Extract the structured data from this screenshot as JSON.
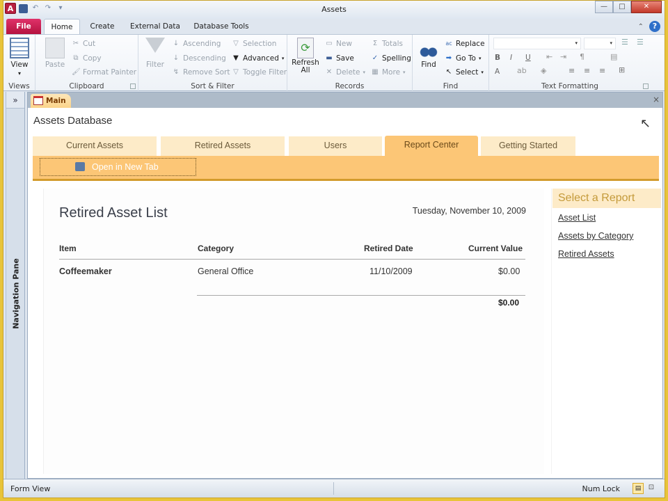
{
  "window": {
    "title": "Assets",
    "controls": {
      "minimize": "—",
      "maximize": "□",
      "close": "✕"
    }
  },
  "quick_access": {
    "app_icon": "A",
    "undo": "↶",
    "redo": "↷",
    "customize": "▾"
  },
  "ribbon_tabs": [
    "File",
    "Home",
    "Create",
    "External Data",
    "Database Tools"
  ],
  "ribbon": {
    "views": {
      "label": "Views",
      "view_btn": "View"
    },
    "clipboard": {
      "label": "Clipboard",
      "paste": "Paste",
      "cut": "Cut",
      "copy": "Copy",
      "format_painter": "Format Painter"
    },
    "sort_filter": {
      "label": "Sort & Filter",
      "filter": "Filter",
      "ascending": "Ascending",
      "descending": "Descending",
      "remove_sort": "Remove Sort",
      "selection": "Selection",
      "advanced": "Advanced",
      "toggle_filter": "Toggle Filter"
    },
    "records": {
      "label": "Records",
      "refresh": "Refresh",
      "refresh2": "All",
      "new": "New",
      "save": "Save",
      "delete": "Delete",
      "totals": "Totals",
      "spelling": "Spelling",
      "more": "More"
    },
    "find": {
      "label": "Find",
      "find": "Find",
      "replace": "Replace",
      "goto": "Go To",
      "select": "Select"
    },
    "text_formatting": {
      "label": "Text Formatting",
      "bold": "B",
      "italic": "I",
      "underline": "U",
      "font_color": "A"
    }
  },
  "nav_pane": {
    "toggle": "»",
    "label": "Navigation Pane"
  },
  "document": {
    "tab_label": "Main",
    "close": "×",
    "form_title": "Assets Database",
    "nav_tabs": [
      "Current Assets",
      "Retired Assets",
      "Users",
      "Report Center",
      "Getting Started"
    ],
    "active_tab": "Report Center",
    "open_new_tab": "Open in New Tab",
    "report": {
      "title": "Retired Asset List",
      "date": "Tuesday, November 10, 2009",
      "columns": [
        "Item",
        "Category",
        "Retired Date",
        "Current Value"
      ],
      "rows": [
        {
          "item": "Coffeemaker",
          "category": "General Office",
          "retired_date": "11/10/2009",
          "current_value": "$0.00"
        }
      ],
      "total": "$0.00"
    },
    "select_report": {
      "header": "Select a Report",
      "links": [
        "Asset List",
        "Assets by Category",
        "Retired Assets"
      ]
    }
  },
  "status_bar": {
    "left": "Form View",
    "num_lock": "Num Lock"
  },
  "colors": {
    "accent_orange": "#fcc676",
    "tab_light": "#fdebc8",
    "file_tab": "#c41a4b"
  }
}
